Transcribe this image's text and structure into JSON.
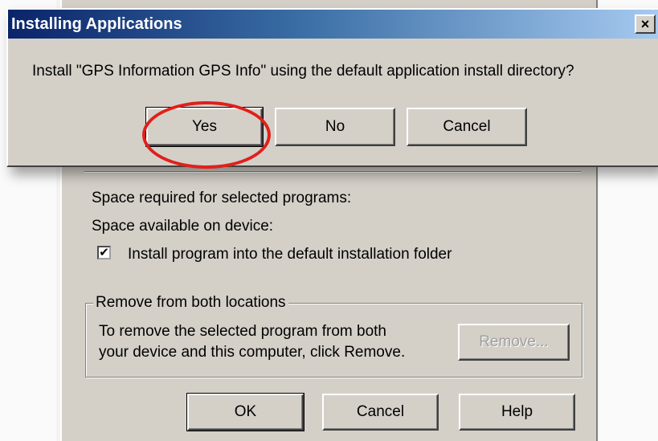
{
  "modal": {
    "title": "Installing Applications",
    "close_label": "×",
    "message": "Install \"GPS Information GPS Info\" using the default application install directory?",
    "buttons": {
      "yes": "Yes",
      "no": "No",
      "cancel": "Cancel"
    },
    "highlight_color": "#e0201c"
  },
  "background_dialog": {
    "space_required_label": "Space required for selected programs:",
    "space_available_label": "Space available on device:",
    "checkbox": {
      "checked": true,
      "mark": "✔",
      "label": "Install program into the default installation folder"
    },
    "remove_group": {
      "title": "Remove from both locations",
      "line1": "To remove the selected program from both",
      "line2": "your device and this computer, click Remove.",
      "remove_button": "Remove..."
    },
    "buttons": {
      "ok": "OK",
      "cancel": "Cancel",
      "help": "Help"
    }
  },
  "colors": {
    "dialog_face": "#d4d0c8",
    "titlebar_start": "#0a246a",
    "titlebar_end": "#a6caf0"
  }
}
